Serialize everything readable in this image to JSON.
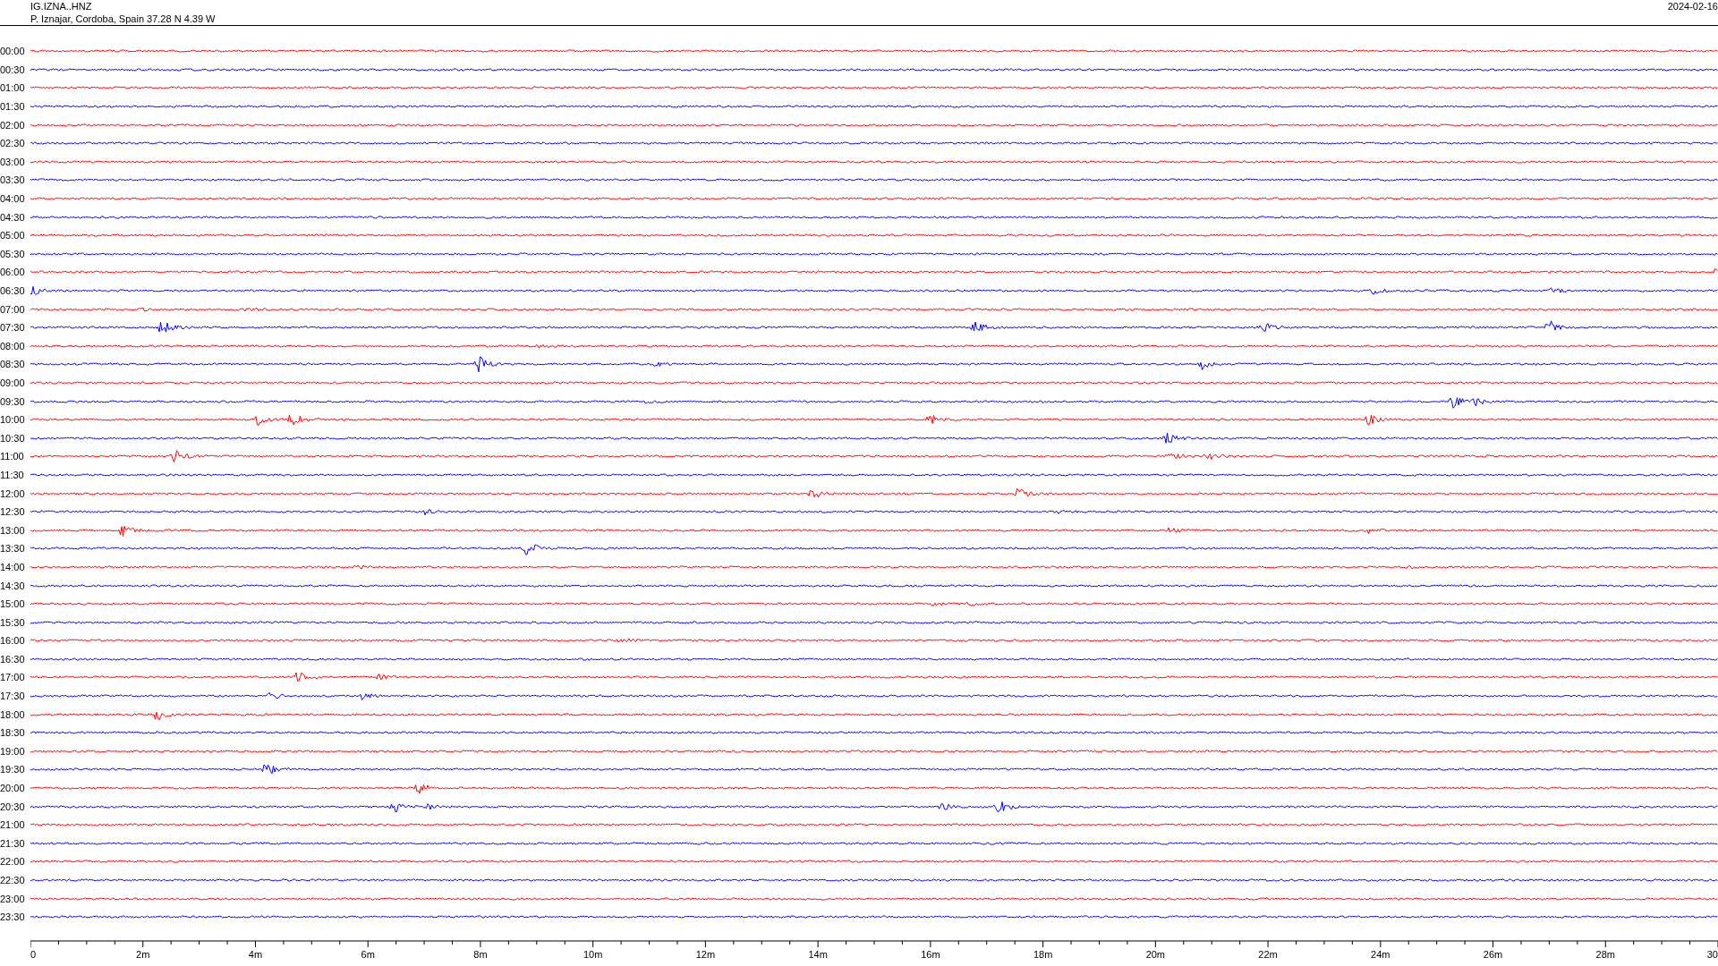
{
  "header": {
    "station": "IG.IZNA..HNZ",
    "location": "P. Iznajar, Cordoba, Spain  37.28 N 4.39 W",
    "date": "2024-02-16"
  },
  "rows": [
    {
      "label": "00:00",
      "color": "#ff0000"
    },
    {
      "label": "00:30",
      "color": "#0000ff"
    },
    {
      "label": "01:00",
      "color": "#ff0000"
    },
    {
      "label": "01:30",
      "color": "#0000ff"
    },
    {
      "label": "02:00",
      "color": "#ff0000"
    },
    {
      "label": "02:30",
      "color": "#0000ff"
    },
    {
      "label": "03:00",
      "color": "#ff0000"
    },
    {
      "label": "03:30",
      "color": "#0000ff"
    },
    {
      "label": "04:00",
      "color": "#ff0000"
    },
    {
      "label": "04:30",
      "color": "#0000ff"
    },
    {
      "label": "05:00",
      "color": "#ff0000"
    },
    {
      "label": "05:30",
      "color": "#0000ff"
    },
    {
      "label": "06:00",
      "color": "#ff0000"
    },
    {
      "label": "06:30",
      "color": "#0000ff"
    },
    {
      "label": "07:00",
      "color": "#ff0000"
    },
    {
      "label": "07:30",
      "color": "#0000ff"
    },
    {
      "label": "08:00",
      "color": "#ff0000"
    },
    {
      "label": "08:30",
      "color": "#0000ff"
    },
    {
      "label": "09:00",
      "color": "#ff0000"
    },
    {
      "label": "09:30",
      "color": "#0000ff"
    },
    {
      "label": "10:00",
      "color": "#ff0000"
    },
    {
      "label": "10:30",
      "color": "#0000ff"
    },
    {
      "label": "11:00",
      "color": "#ff0000"
    },
    {
      "label": "11:30",
      "color": "#0000ff"
    },
    {
      "label": "12:00",
      "color": "#ff0000"
    },
    {
      "label": "12:30",
      "color": "#0000ff"
    },
    {
      "label": "13:00",
      "color": "#ff0000"
    },
    {
      "label": "13:30",
      "color": "#0000ff"
    },
    {
      "label": "14:00",
      "color": "#ff0000"
    },
    {
      "label": "14:30",
      "color": "#0000ff"
    },
    {
      "label": "15:00",
      "color": "#ff0000"
    },
    {
      "label": "15:30",
      "color": "#0000ff"
    },
    {
      "label": "16:00",
      "color": "#ff0000"
    },
    {
      "label": "16:30",
      "color": "#0000ff"
    },
    {
      "label": "17:00",
      "color": "#ff0000"
    },
    {
      "label": "17:30",
      "color": "#0000ff"
    },
    {
      "label": "18:00",
      "color": "#ff0000"
    },
    {
      "label": "18:30",
      "color": "#0000ff"
    },
    {
      "label": "19:00",
      "color": "#ff0000"
    },
    {
      "label": "19:30",
      "color": "#0000ff"
    },
    {
      "label": "20:00",
      "color": "#ff0000"
    },
    {
      "label": "20:30",
      "color": "#0000ff"
    },
    {
      "label": "21:00",
      "color": "#ff0000"
    },
    {
      "label": "21:30",
      "color": "#0000ff"
    },
    {
      "label": "22:00",
      "color": "#ff0000"
    },
    {
      "label": "22:30",
      "color": "#0000ff"
    },
    {
      "label": "23:00",
      "color": "#ff0000"
    },
    {
      "label": "23:30",
      "color": "#0000ff"
    }
  ],
  "x_axis": {
    "ticks": [
      "0",
      "2m",
      "4m",
      "6m",
      "8m",
      "10m",
      "12m",
      "14m",
      "16m",
      "18m",
      "20m",
      "22m",
      "24m",
      "26m",
      "28m",
      "30"
    ]
  }
}
